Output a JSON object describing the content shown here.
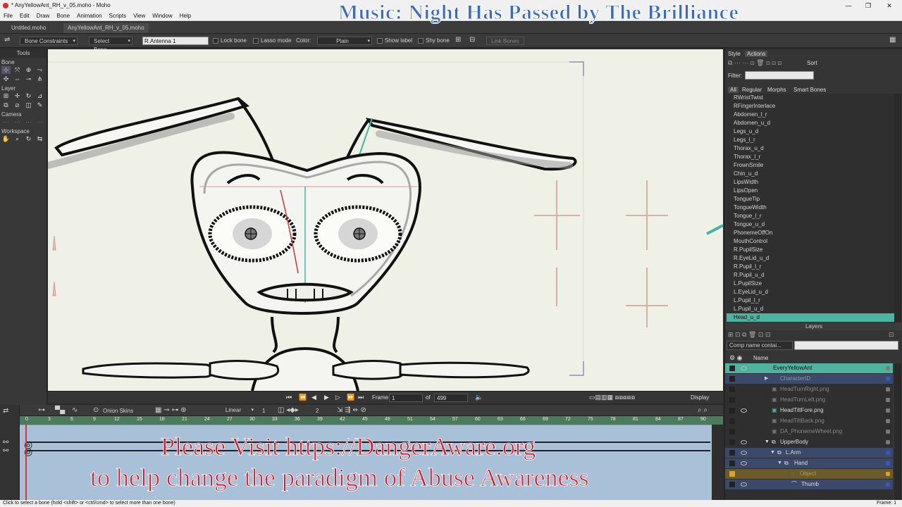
{
  "window": {
    "title": "* AnyYellowAnt_RH_v_05.moho - Moho",
    "min": "—",
    "max": "❐",
    "close": "✕"
  },
  "menu": [
    "File",
    "Edit",
    "Draw",
    "Bone",
    "Animation",
    "Scripts",
    "View",
    "Window",
    "Help"
  ],
  "doc_tabs": [
    "Untitled.moho",
    "AnyYellowAnt_RH_v_05.moho"
  ],
  "tool_options": {
    "bone_constraints": "Bone Constraints",
    "select_bone": "Select Bone",
    "bone_name": "R.Antenna 1",
    "lock_bone": "Lock bone",
    "lasso_mode": "Lasso mode",
    "color_label": "Color:",
    "color_value": "Plain",
    "show_label": "Show label",
    "shy_bone": "Shy bone",
    "link_bones": "Link Bones"
  },
  "tools_panel": {
    "title": "Tools",
    "sections": [
      "Bone",
      "Layer",
      "Camera",
      "Workspace"
    ]
  },
  "transport": {
    "frame_label": "Frame",
    "frame_value": "1",
    "of_label": "of",
    "total_frames": "499",
    "display_label": "Display"
  },
  "timeline": {
    "onion_skins": "Onion Skins",
    "interp": "Linear",
    "interp_num": "1",
    "keys_num": "2",
    "ruler": [
      "0",
      "3",
      "6",
      "9",
      "12",
      "15",
      "18",
      "21",
      "24",
      "27",
      "30",
      "33",
      "36",
      "39",
      "42",
      "45",
      "48",
      "51",
      "54",
      "57",
      "60",
      "63",
      "66",
      "69",
      "72",
      "75",
      "78",
      "81",
      "84",
      "87",
      "90"
    ]
  },
  "right_panel": {
    "tabs": [
      "Style",
      "Actions"
    ],
    "sort_label": "Sort",
    "filter_label": "Filter:",
    "filter_tabs": [
      "All",
      "Regular",
      "Morphs",
      "Smart Bones"
    ],
    "actions": [
      "RWristTwist",
      "RFingerInterlace",
      "Abdomen_l_r",
      "Abdomen_u_d",
      "Legs_u_d",
      "Legs_l_r",
      "Thorax_u_d",
      "Thorax_l_r",
      "FrownSmile",
      "Chin_u_d",
      "LipsWidth",
      "LipsOpen",
      "TongueTip",
      "TongueWidth",
      "Tongue_l_r",
      "Tongue_u_d",
      "PhonemeOffOn",
      "MouthControl",
      "R.PupilSize",
      "R.EyeLid_u_d",
      "R.Pupil_l_r",
      "R.Pupil_u_d",
      "L.PupilSize",
      "L.EyeLid_u_d",
      "L.Pupil_l_r",
      "L.Pupil_u_d",
      "Head_u_d"
    ],
    "selected_action": "Head_u_d",
    "layers_title": "Layers",
    "layer_filter": "Comp name contai...",
    "name_col": "Name",
    "layers": [
      {
        "name": "EveryYellowAnt",
        "indent": 0,
        "type": "group",
        "bg": "#4fb3a0",
        "dot": "#7a7a7a",
        "dim": false
      },
      {
        "name": "CharacterID",
        "indent": 1,
        "type": "group",
        "bg": "#3b4a6b",
        "dot": "#3b58b8",
        "dim": true
      },
      {
        "name": "HeadTurnRight.png",
        "indent": 1,
        "type": "image",
        "bg": "#2f2f2f",
        "dot": "#7a7a7a",
        "dim": true
      },
      {
        "name": "HeadTurnLeft.png",
        "indent": 1,
        "type": "image",
        "bg": "#2f2f2f",
        "dot": "#7a7a7a",
        "dim": true
      },
      {
        "name": "HeadTiltFore.png",
        "indent": 1,
        "type": "image",
        "bg": "#2f2f2f",
        "dot": "#7a7a7a",
        "dim": false
      },
      {
        "name": "HeadTiltBack.png",
        "indent": 1,
        "type": "image",
        "bg": "#2f2f2f",
        "dot": "#7a7a7a",
        "dim": true
      },
      {
        "name": "DA_PhonemeWheel.png",
        "indent": 1,
        "type": "image",
        "bg": "#2f2f2f",
        "dot": "#7a7a7a",
        "dim": true
      },
      {
        "name": "UpperBody",
        "indent": 1,
        "type": "group",
        "bg": "#2f2f2f",
        "dot": "#7a7a7a",
        "dim": false
      },
      {
        "name": "L.Arm",
        "indent": 2,
        "type": "group",
        "bg": "#3b4a6b",
        "dot": "#3b58b8",
        "dim": false
      },
      {
        "name": "Hand",
        "indent": 3,
        "type": "group",
        "bg": "#3b4a6b",
        "dot": "#3b58b8",
        "dim": false
      },
      {
        "name": "Object",
        "indent": 4,
        "type": "vector",
        "bg": "#6b5a2a",
        "dot": "#d9a62c",
        "dim": true
      },
      {
        "name": "Thumb",
        "indent": 4,
        "type": "bone",
        "bg": "#3b4a6b",
        "dot": "#3b58b8",
        "dim": false
      }
    ]
  },
  "status": "Click to select a bone (hold <shift> or <ctrl/cmd> to select more than one bone)",
  "status_right": "Frame: 1",
  "overlays": {
    "music": "Music:    Night Has Passed by The Brilliance",
    "visit_line1": "Please Visit https://DangerAware.org",
    "visit_line2": "to help change the paradigm of Abuse Awareness"
  }
}
